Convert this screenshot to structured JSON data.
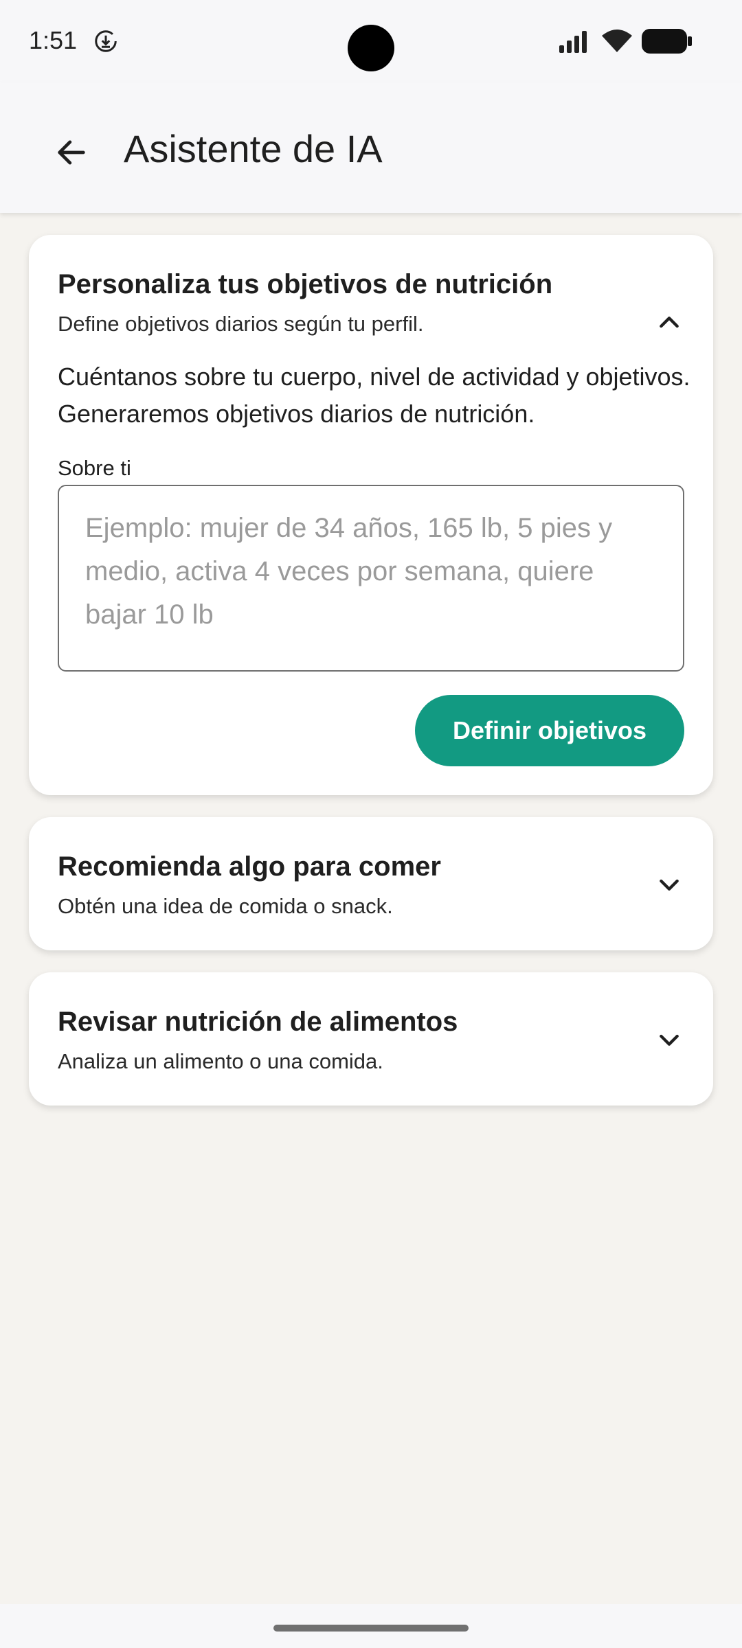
{
  "status": {
    "time": "1:51",
    "icons": [
      "download-icon",
      "signal-icon",
      "wifi-icon",
      "battery-icon"
    ]
  },
  "app_bar": {
    "title": "Asistente de IA",
    "back_icon": "arrow-back-icon"
  },
  "cards": [
    {
      "title": "Personaliza tus objetivos de nutrición",
      "subtitle": "Define objetivos diarios según tu perfil.",
      "expanded": true,
      "intro": "Cuéntanos sobre tu cuerpo, nivel de actividad y objetivos. Generaremos objetivos diarios de nutrición.",
      "field_label": "Sobre ti",
      "field_value": "",
      "field_placeholder": "Ejemplo: mujer de 34 años, 165 lb, 5 pies y medio, activa 4 veces por semana, quiere bajar 10 lb",
      "button_label": "Definir objetivos"
    },
    {
      "title": "Recomienda algo para comer",
      "subtitle": "Obtén una idea de comida o snack.",
      "expanded": false
    },
    {
      "title": "Revisar nutrición de alimentos",
      "subtitle": "Analiza un alimento o una comida.",
      "expanded": false
    }
  ],
  "colors": {
    "accent": "#129a82",
    "background": "#f5f3ef",
    "card": "#ffffff",
    "app_bar": "#f7f7f9"
  }
}
